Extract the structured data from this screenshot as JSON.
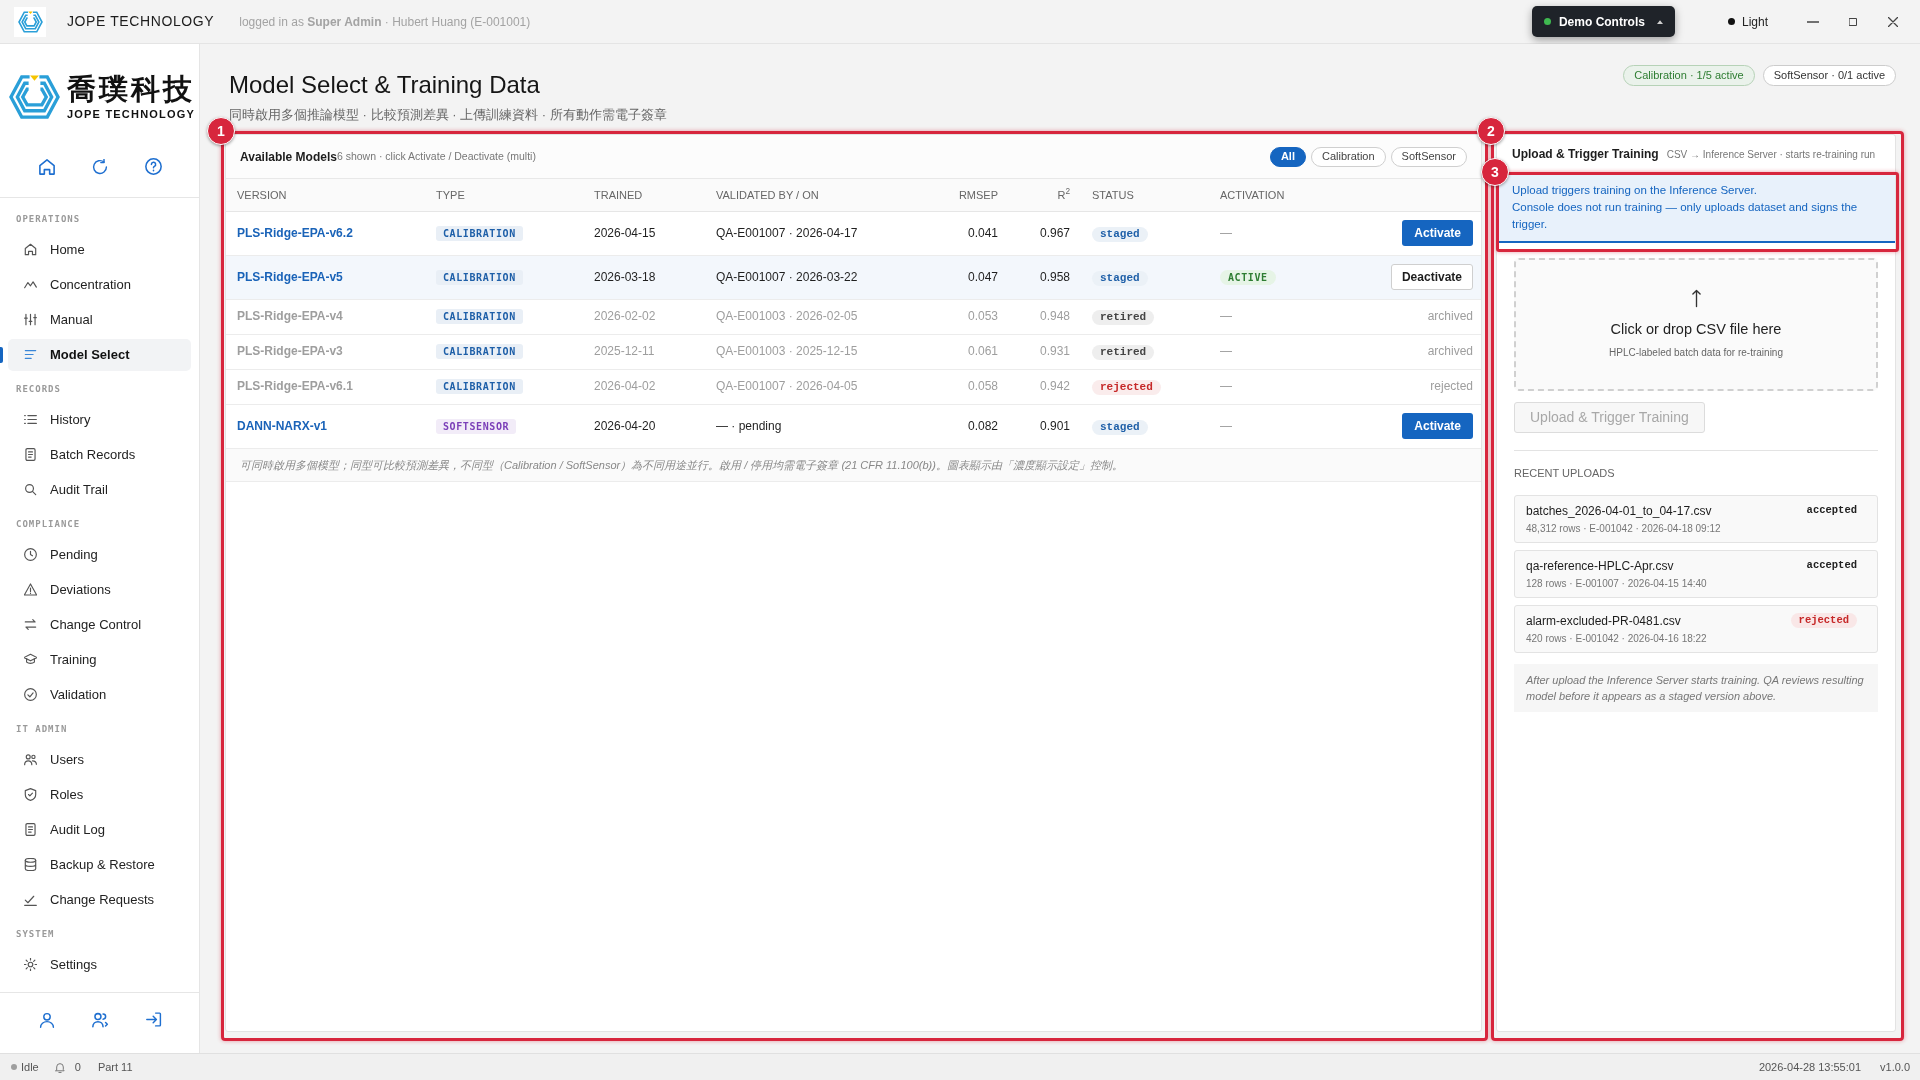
{
  "titlebar": {
    "brand": "JOPE TECHNOLOGY",
    "session": "logged in as **Super Admin** · Hubert Huang (E-001001)",
    "demo_controls": "Demo Controls",
    "theme": "Light"
  },
  "sidebar": {
    "logo": {
      "name": "喬璞科技",
      "tagline": "JOPE TECHNOLOGY"
    },
    "sections": [
      {
        "title": "OPERATIONS",
        "items": [
          {
            "label": "Home",
            "selected": false
          },
          {
            "label": "Concentration",
            "selected": false
          },
          {
            "label": "Manual",
            "selected": false
          },
          {
            "label": "Model Select",
            "selected": true
          }
        ]
      },
      {
        "title": "RECORDS",
        "items": [
          {
            "label": "History",
            "selected": false
          },
          {
            "label": "Batch Records",
            "selected": false
          },
          {
            "label": "Audit Trail",
            "selected": false
          }
        ]
      },
      {
        "title": "COMPLIANCE",
        "items": [
          {
            "label": "Pending",
            "selected": false
          },
          {
            "label": "Deviations",
            "selected": false
          },
          {
            "label": "Change Control",
            "selected": false
          },
          {
            "label": "Training",
            "selected": false
          },
          {
            "label": "Validation",
            "selected": false
          }
        ]
      },
      {
        "title": "IT ADMIN",
        "items": [
          {
            "label": "Users",
            "selected": false
          },
          {
            "label": "Roles",
            "selected": false
          },
          {
            "label": "Audit Log",
            "selected": false
          },
          {
            "label": "Backup & Restore",
            "selected": false
          },
          {
            "label": "Change Requests",
            "selected": false
          }
        ]
      },
      {
        "title": "SYSTEM",
        "items": [
          {
            "label": "Settings",
            "selected": false
          }
        ]
      }
    ]
  },
  "page": {
    "title": "Model Select & Training Data",
    "subtitle": "同時啟用多個推論模型 · 比較預測差異 · 上傳訓練資料 · 所有動作需電子簽章",
    "summary_badges": [
      {
        "text": "Calibration · 1/5 active",
        "color": "#2e7d32",
        "filled": true
      },
      {
        "text": "SoftSensor · 0/1 active",
        "color": "#333333",
        "filled": false
      }
    ]
  },
  "models_panel": {
    "annotation": "1",
    "title": "Available Models",
    "hint": "6 shown · click Activate / Deactivate (multi)",
    "filters": [
      {
        "label": "All",
        "selected": true
      },
      {
        "label": "Calibration",
        "selected": false
      },
      {
        "label": "SoftSensor",
        "selected": false
      }
    ],
    "columns": [
      "VERSION",
      "TYPE",
      "TRAINED",
      "VALIDATED BY / ON",
      "RMSEP",
      "R$^{2}$",
      "STATUS",
      "ACTIVATION"
    ],
    "rows": [
      {
        "version": "PLS-Ridge-EPA-v6.2",
        "type": {
          "text": "CALIBRATION",
          "color": "#1e5fa8"
        },
        "trained": "2026-04-15",
        "validated": "QA-E001007 · 2026-04-17",
        "rmsep": "0.041",
        "r2": "0.967",
        "status": {
          "text": "staged",
          "color": "#1e5fa8"
        },
        "activation": "—",
        "active": false,
        "dimmed": false,
        "action": {
          "kind": "primary",
          "label": "Activate"
        }
      },
      {
        "version": "PLS-Ridge-EPA-v5",
        "type": {
          "text": "CALIBRATION",
          "color": "#1e5fa8"
        },
        "trained": "2026-03-18",
        "validated": "QA-E001007 · 2026-03-22",
        "rmsep": "0.047",
        "r2": "0.958",
        "status": {
          "text": "staged",
          "color": "#1e5fa8"
        },
        "activation": "ACTIVE",
        "active": true,
        "dimmed": false,
        "action": {
          "kind": "secondary",
          "label": "Deactivate"
        }
      },
      {
        "version": "PLS-Ridge-EPA-v4",
        "type": {
          "text": "CALIBRATION",
          "color": "#1e5fa8"
        },
        "trained": "2026-02-02",
        "validated": "QA-E001003 · 2026-02-05",
        "rmsep": "0.053",
        "r2": "0.948",
        "status": {
          "text": "retired",
          "color": "#444444"
        },
        "activation": "—",
        "active": false,
        "dimmed": true,
        "action": {
          "kind": "text",
          "label": "archived"
        }
      },
      {
        "version": "PLS-Ridge-EPA-v3",
        "type": {
          "text": "CALIBRATION",
          "color": "#1e5fa8"
        },
        "trained": "2025-12-11",
        "validated": "QA-E001003 · 2025-12-15",
        "rmsep": "0.061",
        "r2": "0.931",
        "status": {
          "text": "retired",
          "color": "#444444"
        },
        "activation": "—",
        "active": false,
        "dimmed": true,
        "action": {
          "kind": "text",
          "label": "archived"
        }
      },
      {
        "version": "PLS-Ridge-EPA-v6.1",
        "type": {
          "text": "CALIBRATION",
          "color": "#1e5fa8"
        },
        "trained": "2026-04-02",
        "validated": "QA-E001007 · 2026-04-05",
        "rmsep": "0.058",
        "r2": "0.942",
        "status": {
          "text": "rejected",
          "color": "#c62828"
        },
        "activation": "—",
        "active": false,
        "dimmed": true,
        "action": {
          "kind": "text",
          "label": "rejected"
        }
      },
      {
        "version": "DANN-NARX-v1",
        "type": {
          "text": "SOFTSENSOR",
          "color": "#7b3fb8"
        },
        "trained": "2026-04-20",
        "validated": "— · pending",
        "rmsep": "0.082",
        "r2": "0.901",
        "status": {
          "text": "staged",
          "color": "#1e5fa8"
        },
        "activation": "—",
        "active": false,
        "dimmed": false,
        "action": {
          "kind": "primary",
          "label": "Activate"
        }
      }
    ],
    "footnote": "可同時啟用多個模型；同型可比較預測差異，不同型（Calibration / SoftSensor）為不同用途並行。啟用 / 停用均需電子簽章 (21 CFR 11.100(b))。圖表顯示由「濃度顯示設定」控制。"
  },
  "upload_panel": {
    "annotation": "2",
    "title": "Upload & Trigger Training",
    "subtitle": "CSV → Inference Server · starts re-training run",
    "notice": {
      "annotation": "3",
      "lines": [
        "Upload triggers training on the Inference Server.",
        "Console does not run training — only uploads dataset and signs the trigger."
      ]
    },
    "dropzone": {
      "title": "Click or drop CSV file here",
      "hint": "HPLC-labeled batch data for re-training"
    },
    "submit": {
      "label": "Upload & Trigger Training",
      "disabled": true
    },
    "recent_title": "RECENT UPLOADS",
    "uploads": [
      {
        "file": "batches_2026-04-01_to_04-17.csv",
        "meta": "48,312 rows · E-001042 · 2026-04-18 09:12",
        "status": {
          "text": "accepted",
          "color": "#222222",
          "filled": false
        }
      },
      {
        "file": "qa-reference-HPLC-Apr.csv",
        "meta": "128 rows · E-001007 · 2026-04-15 14:40",
        "status": {
          "text": "accepted",
          "color": "#222222",
          "filled": false
        }
      },
      {
        "file": "alarm-excluded-PR-0481.csv",
        "meta": "420 rows · E-001042 · 2026-04-16 18:22",
        "status": {
          "text": "rejected",
          "color": "#c62828",
          "filled": true
        }
      }
    ],
    "note": "After upload the Inference Server starts training. QA reviews resulting model before it appears as a staged version above."
  },
  "status_bar": {
    "state": "Idle",
    "notifications": "0",
    "compliance": "Part 11",
    "timestamp": "2026-04-28 13:55:01",
    "version": "v1.0.0"
  }
}
